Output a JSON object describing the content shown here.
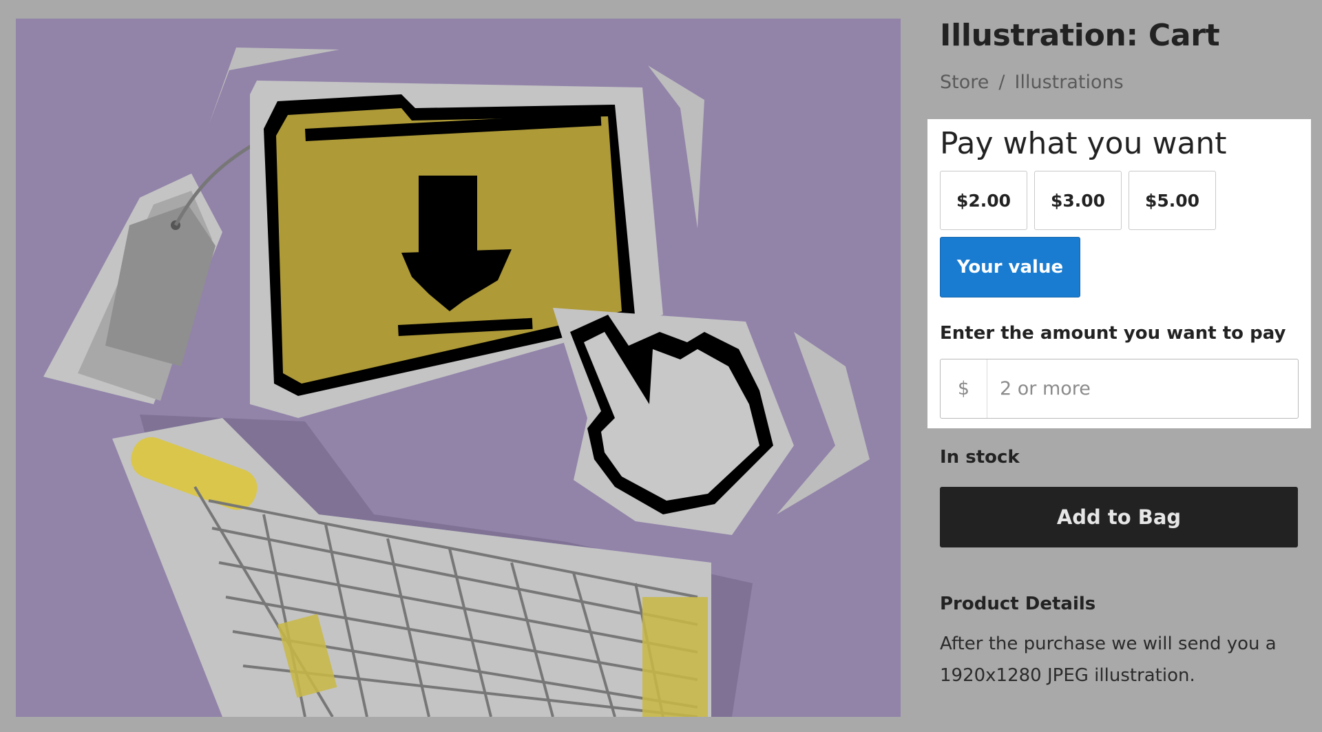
{
  "product": {
    "title": "Illustration: Cart",
    "breadcrumb": [
      {
        "label": "Store"
      },
      {
        "label": "Illustrations"
      }
    ],
    "breadcrumb_separator": "/"
  },
  "pricing": {
    "heading": "Pay what you want",
    "options": [
      "$2.00",
      "$3.00",
      "$5.00"
    ],
    "custom_option_label": "Your value",
    "amount_label": "Enter the amount you want to pay",
    "currency_symbol": "$",
    "amount_placeholder": "2 or more",
    "amount_value": ""
  },
  "stock": {
    "label": "In stock"
  },
  "cart": {
    "add_to_bag_label": "Add to Bag"
  },
  "details": {
    "heading": "Product Details",
    "text": "After the purchase we will send you a 1920x1280 JPEG illustration."
  },
  "image": {
    "description_icons": [
      "download-folder-icon",
      "pointer-hand-icon",
      "price-tag-icon",
      "shopping-cart-icon"
    ]
  },
  "colors": {
    "page_background": "#a9a9a9",
    "image_background": "#9283a9",
    "folder_yellow": "#ae9a37",
    "accent_blue": "#1a7cd0",
    "button_dark": "#222222"
  }
}
